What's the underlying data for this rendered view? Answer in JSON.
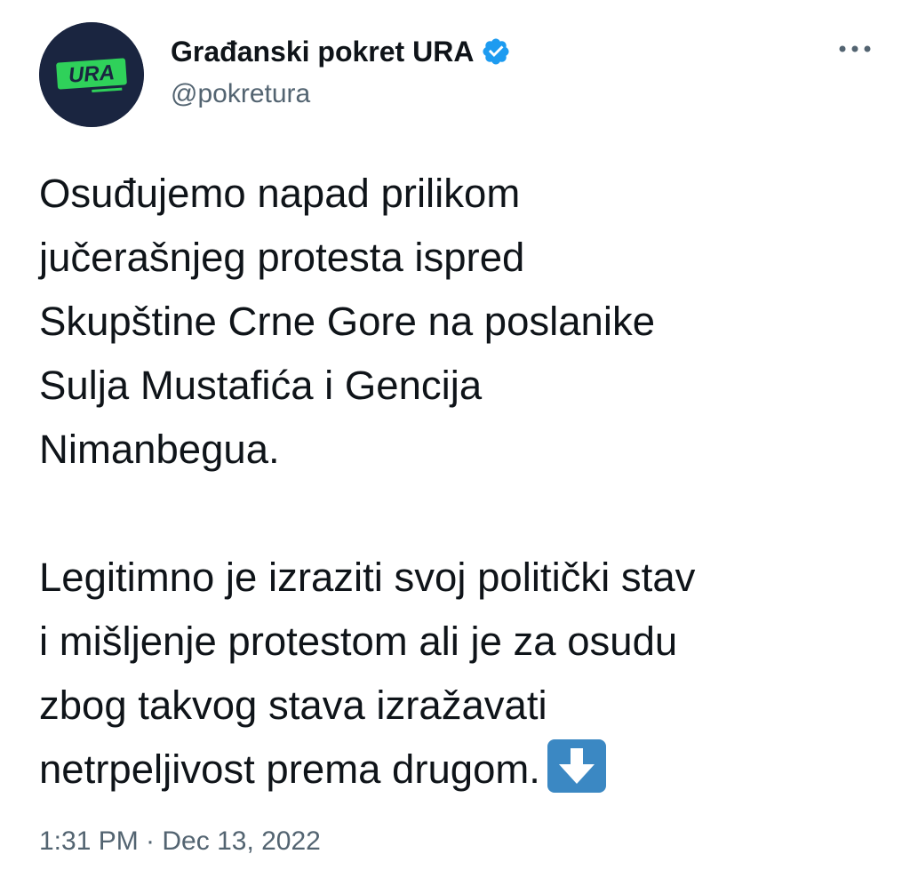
{
  "tweet": {
    "author": {
      "display_name": "Građanski pokret URA",
      "handle": "@pokretura",
      "verified": true,
      "avatar_logo_text": "URA",
      "avatar_colors": {
        "background": "#1a2540",
        "logo": "#2fd15a"
      }
    },
    "body": {
      "paragraph_1": "Osuđujemo napad prilikom\njučerašnjeg protesta ispred\nSkupštine Crne Gore na poslanike\nSulja Mustafića i Gencija\nNimanbegua.",
      "paragraph_2": "Legitimno je izraziti svoj politički stav\ni mišljenje protestom ali je za osudu\nzbog takvog stava izražavati\nnetrpeljivost prema drugom.",
      "trailing_emoji": "down-arrow-emoji"
    },
    "timestamp": "1:31 PM · Dec 13, 2022",
    "menu_icon": "more-options-icon",
    "colors": {
      "text": "#0f1419",
      "secondary": "#536471",
      "verified": "#1d9bf0",
      "emoji_bg": "#3b88c3"
    }
  }
}
